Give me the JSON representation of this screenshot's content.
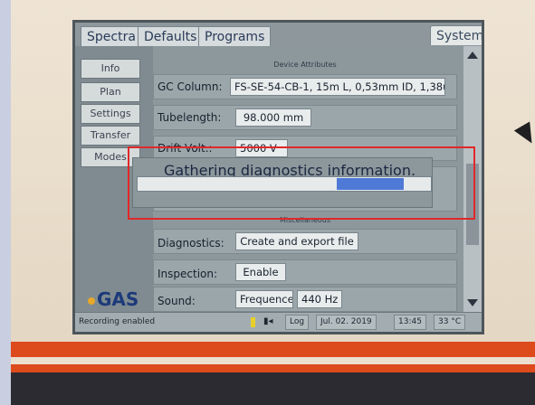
{
  "tabs": [
    "Spectra",
    "Defaults",
    "Programs"
  ],
  "system_tab": "System",
  "sidebar": {
    "items": [
      "Info",
      "Plan",
      "Settings",
      "Transfer",
      "Modes"
    ]
  },
  "logo_text": "GAS",
  "device_attributes": {
    "section_title": "Device Attributes",
    "gc_column_label": "GC Column:",
    "gc_column_value": "FS-SE-54-CB-1, 15m L, 0,53mm ID, 1,38u...",
    "tubelength_label": "Tubelength:",
    "tubelength_value": "98.000 mm",
    "drift_volt_label": "Drift Volt.:",
    "drift_volt_value": "5000 V"
  },
  "misc": {
    "section_title": "Miscellaneous",
    "diagnostics_label": "Diagnostics:",
    "diagnostics_button": "Create and export file",
    "inspection_label": "Inspection:",
    "inspection_button": "Enable",
    "sound_label": "Sound:",
    "sound_button": "Frequence",
    "sound_value": "440 Hz"
  },
  "dialog": {
    "message": "Gathering diagnostics information.",
    "progress": 0.55
  },
  "statusbar": {
    "recording": "Recording enabled",
    "log": "Log",
    "date": "Jul. 02. 2019",
    "time": "13:45",
    "temperature": "33 °C"
  },
  "colors": {
    "highlight_box": "#e0282a",
    "progress_fill": "#4f79d6"
  }
}
